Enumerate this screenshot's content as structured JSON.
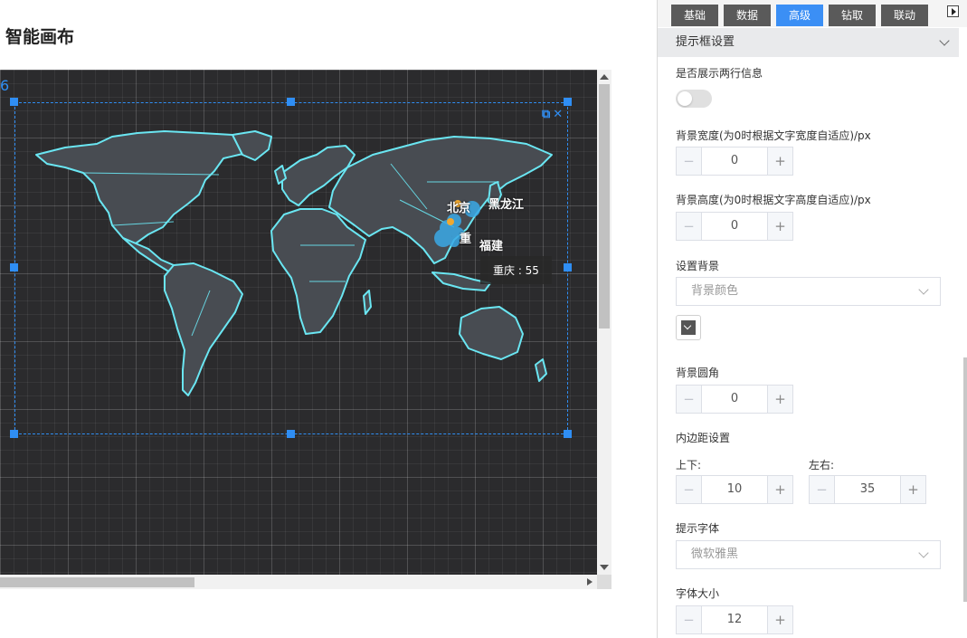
{
  "canvas": {
    "title": "智能画布",
    "widget_number": "6",
    "widget_icons": "⧉✕"
  },
  "map": {
    "tooltip": "重庆 : 55",
    "labels": [
      "北京",
      "黑龙江",
      "重",
      "福建"
    ],
    "land_color": "#484c52",
    "border_color": "#6ae6f2",
    "bubble_color": "#3aa9e6"
  },
  "tabs": [
    {
      "label": "基础"
    },
    {
      "label": "数据"
    },
    {
      "label": "高级"
    },
    {
      "label": "钻取"
    },
    {
      "label": "联动"
    }
  ],
  "active_tab": "高级",
  "panel": {
    "section_title": "提示框设置",
    "two_row_label": "是否展示两行信息",
    "bg_width_label": "背景宽度(为0时根据文字宽度自适应)/px",
    "bg_width_value": "0",
    "bg_height_label": "背景高度(为0时根据文字高度自适应)/px",
    "bg_height_value": "0",
    "bg_setting_label": "设置背景",
    "bg_setting_value": "背景颜色",
    "bg_radius_label": "背景圆角",
    "bg_radius_value": "0",
    "padding_label": "内边距设置",
    "padding_tb_label": "上下:",
    "padding_tb_value": "10",
    "padding_lr_label": "左右:",
    "padding_lr_value": "35",
    "font_label": "提示字体",
    "font_value": "微软雅黑",
    "font_size_label": "字体大小",
    "font_size_value": "12",
    "minus": "−",
    "plus": "+"
  }
}
